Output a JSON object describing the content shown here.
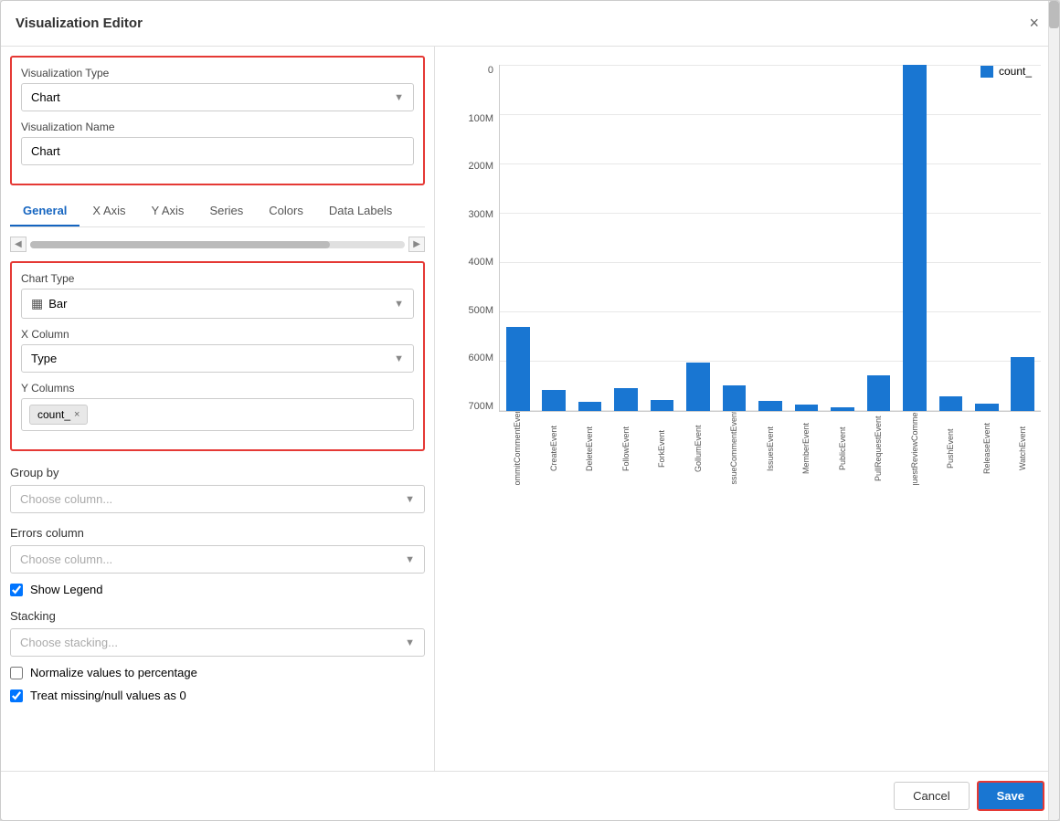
{
  "modal": {
    "title": "Visualization Editor",
    "close_label": "×"
  },
  "left": {
    "viz_type_label": "Visualization Type",
    "viz_type_value": "Chart",
    "viz_name_label": "Visualization Name",
    "viz_name_value": "Chart",
    "tabs": [
      "General",
      "X Axis",
      "Y Axis",
      "Series",
      "Colors",
      "Data Labels"
    ],
    "active_tab": "General",
    "chart_type_label": "Chart Type",
    "chart_type_value": "Bar",
    "x_column_label": "X Column",
    "x_column_placeholder": "Type",
    "y_columns_label": "Y Columns",
    "y_column_tag": "count_",
    "group_by_label": "Group by",
    "group_by_placeholder": "Choose column...",
    "errors_column_label": "Errors column",
    "errors_column_placeholder": "Choose column...",
    "show_legend_label": "Show Legend",
    "show_legend_checked": true,
    "stacking_label": "Stacking",
    "stacking_placeholder": "Choose stacking...",
    "normalize_label": "Normalize values to percentage",
    "normalize_checked": false,
    "treat_missing_label": "Treat missing/null values as 0",
    "treat_missing_checked": true
  },
  "chart": {
    "legend_label": "count_",
    "y_axis_labels": [
      "0",
      "100M",
      "200M",
      "300M",
      "400M",
      "500M",
      "600M",
      "700M"
    ],
    "bars": [
      {
        "label": "CommitCommentEvent",
        "value": 165,
        "max": 680
      },
      {
        "label": "CreateEvent",
        "value": 42,
        "max": 680
      },
      {
        "label": "DeleteEvent",
        "value": 18,
        "max": 680
      },
      {
        "label": "FollowEvent",
        "value": 45,
        "max": 680
      },
      {
        "label": "ForkEvent",
        "value": 22,
        "max": 680
      },
      {
        "label": "GollumEvent",
        "value": 95,
        "max": 680
      },
      {
        "label": "IssueCommentEvent",
        "value": 50,
        "max": 680
      },
      {
        "label": "IssuesEvent",
        "value": 20,
        "max": 680
      },
      {
        "label": "MemberEvent",
        "value": 12,
        "max": 680
      },
      {
        "label": "PublicEvent",
        "value": 8,
        "max": 680
      },
      {
        "label": "PullRequestEvent",
        "value": 70,
        "max": 680
      },
      {
        "label": "PullRequestReviewCommentEvent",
        "value": 680,
        "max": 680
      },
      {
        "label": "PushEvent",
        "value": 28,
        "max": 680
      },
      {
        "label": "ReleaseEvent",
        "value": 15,
        "max": 680
      },
      {
        "label": "WatchEvent",
        "value": 105,
        "max": 680
      }
    ]
  },
  "footer": {
    "cancel_label": "Cancel",
    "save_label": "Save"
  }
}
